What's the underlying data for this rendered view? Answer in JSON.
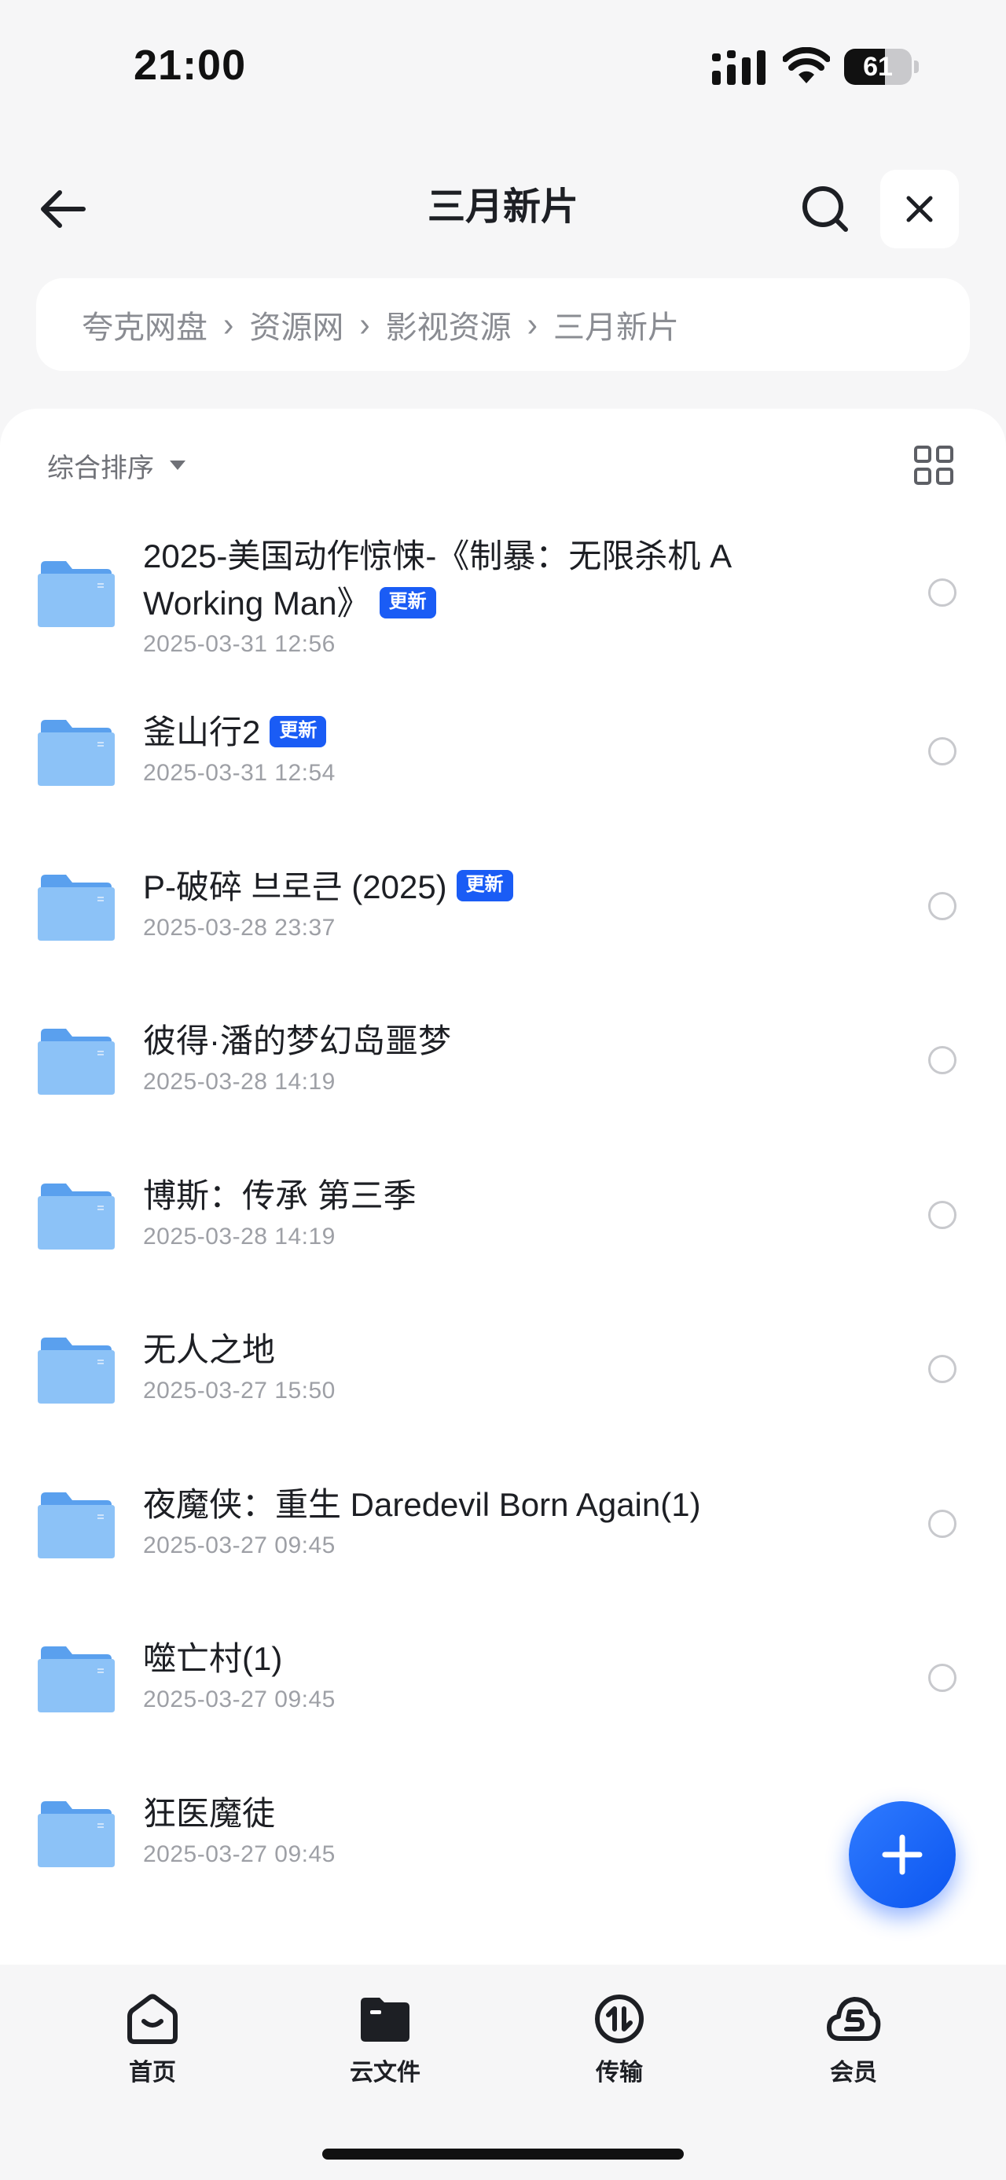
{
  "status_bar": {
    "time": "21:00",
    "battery_level": "61",
    "battery_fraction": 0.61
  },
  "nav": {
    "title": "三月新片"
  },
  "breadcrumb": [
    "夸克网盘",
    "资源网",
    "影视资源",
    "三月新片"
  ],
  "toolbar": {
    "sort_label": "综合排序"
  },
  "files": [
    {
      "name": "2025-美国动作惊悚-《制暴：无限杀机 A Working Man》",
      "date": "2025-03-31 12:56",
      "badge": "更新"
    },
    {
      "name": "釜山行2",
      "date": "2025-03-31 12:54",
      "badge": "更新"
    },
    {
      "name": "P-破碎 브로큰 (2025)",
      "date": "2025-03-28 23:37",
      "badge": "更新"
    },
    {
      "name": "彼得·潘的梦幻岛噩梦",
      "date": "2025-03-28 14:19",
      "badge": ""
    },
    {
      "name": "博斯：传承 第三季",
      "date": "2025-03-28 14:19",
      "badge": ""
    },
    {
      "name": "无人之地",
      "date": "2025-03-27 15:50",
      "badge": ""
    },
    {
      "name": "夜魔侠：重生 Daredevil Born Again(1)",
      "date": "2025-03-27 09:45",
      "badge": ""
    },
    {
      "name": "噬亡村(1)",
      "date": "2025-03-27 09:45",
      "badge": ""
    },
    {
      "name": "狂医魔徒",
      "date": "2025-03-27 09:45",
      "badge": ""
    }
  ],
  "bottom_nav": [
    {
      "label": "首页",
      "icon": "home-icon"
    },
    {
      "label": "云文件",
      "icon": "cloud-folder-icon"
    },
    {
      "label": "传输",
      "icon": "transfer-icon"
    },
    {
      "label": "会员",
      "icon": "vip-cloud-icon"
    }
  ],
  "colors": {
    "accent": "#1a5cf5",
    "folder": "#78b4f5",
    "background": "#f6f6f7"
  }
}
